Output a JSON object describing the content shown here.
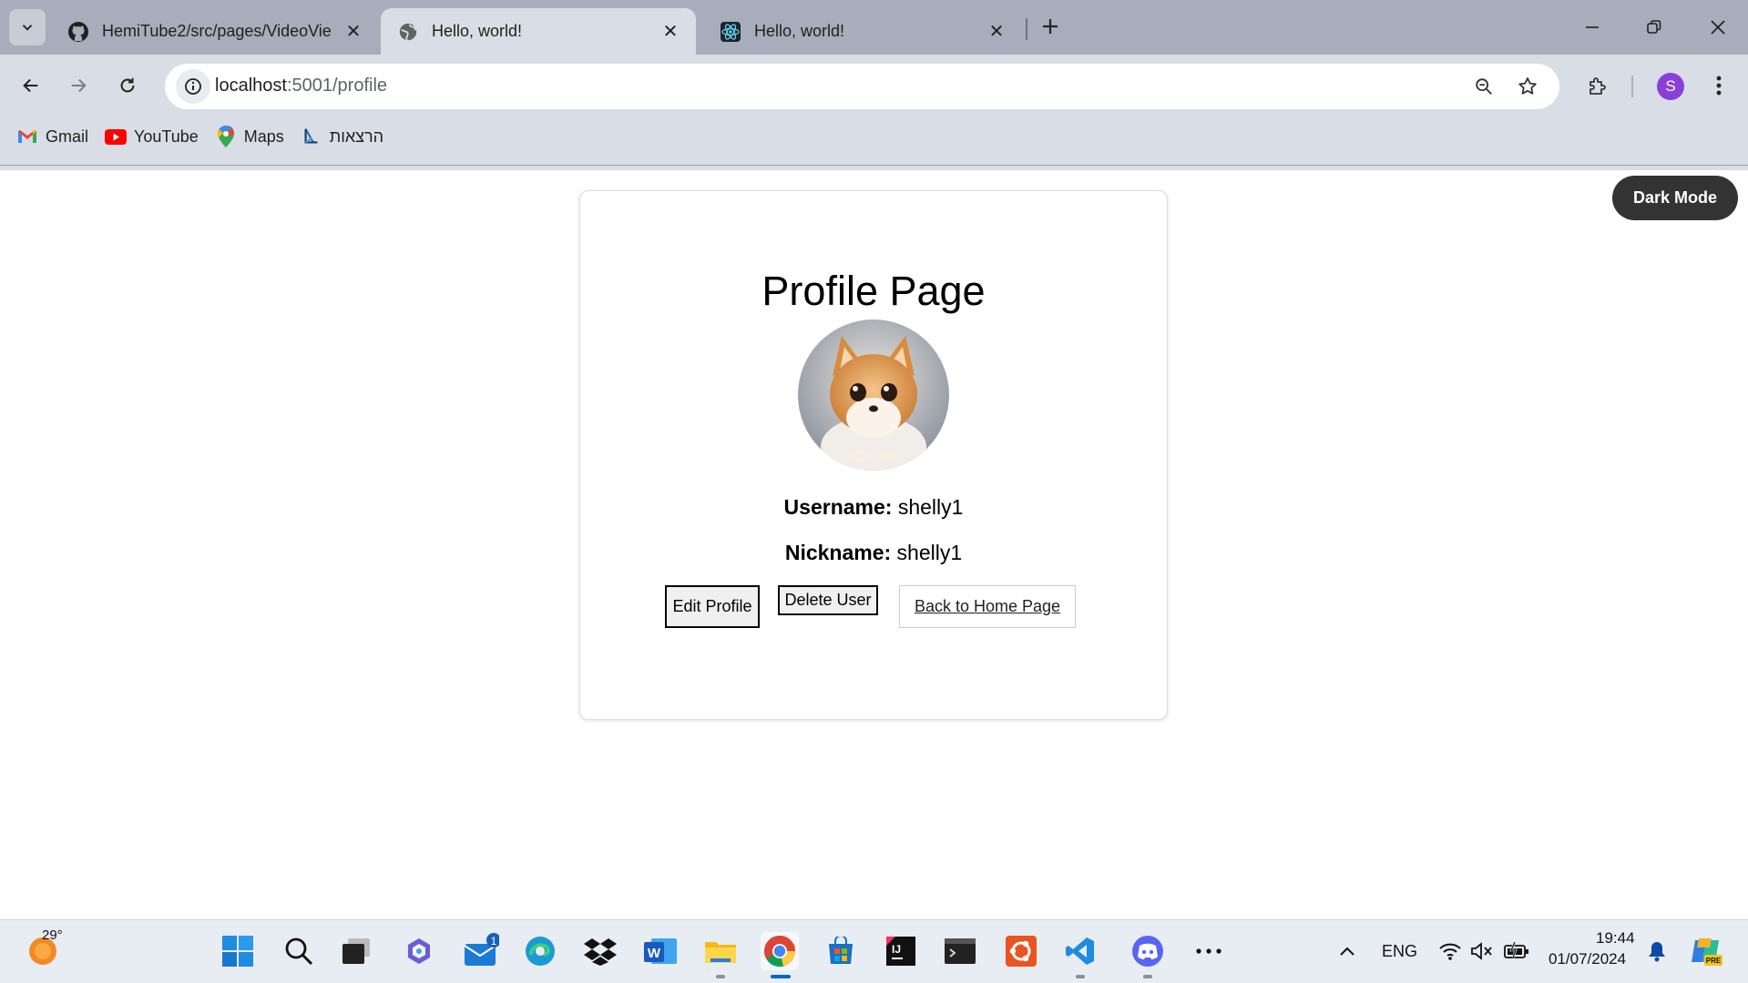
{
  "browser": {
    "tabs": [
      {
        "title": "HemiTube2/src/pages/VideoVie",
        "icon": "github-icon",
        "active": false
      },
      {
        "title": "Hello, world!",
        "icon": "globe-icon",
        "active": true
      },
      {
        "title": "Hello, world!",
        "icon": "react-icon",
        "active": false
      }
    ],
    "url_host": "localhost",
    "url_path": ":5001/profile",
    "profile_initial": "S",
    "bookmarks": [
      {
        "label": "Gmail",
        "icon": "gmail-icon"
      },
      {
        "label": "YouTube",
        "icon": "youtube-icon"
      },
      {
        "label": "Maps",
        "icon": "maps-icon"
      },
      {
        "label": "הרצאות",
        "icon": "drive-icon"
      }
    ]
  },
  "page": {
    "dark_mode_label": "Dark Mode",
    "title": "Profile Page",
    "username_label": "Username:",
    "username_value": "shelly1",
    "nickname_label": "Nickname:",
    "nickname_value": "shelly1",
    "edit_button": "Edit Profile",
    "delete_button": "Delete User",
    "home_link": "Back to Home Page"
  },
  "taskbar": {
    "weather_temp": "29°",
    "mail_badge": "1",
    "language": "ENG",
    "time": "19:44",
    "date": "01/07/2024",
    "copilot_badge": "PRE"
  }
}
